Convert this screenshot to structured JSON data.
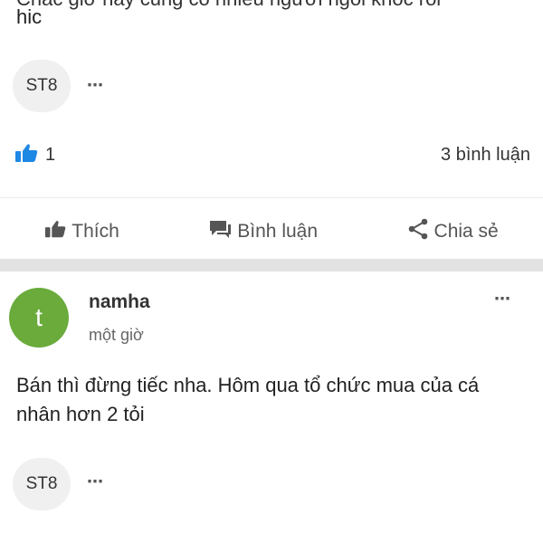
{
  "post1": {
    "cut_text": "Chắc giờ này cũng có nhiều người ngồi khóc rồi",
    "text_tail": "hic",
    "tag_label": "ST8",
    "like_count": "1",
    "comments_count": "3 bình luận"
  },
  "actions": {
    "like_label": "Thích",
    "comment_label": "Bình luận",
    "share_label": "Chia sẻ"
  },
  "post2": {
    "avatar_letter": "t",
    "author": "namha",
    "time": "một giờ",
    "body": "Bán thì đừng tiếc nha. Hôm qua tổ chức mua của cá nhân hơn 2 tỏi",
    "tag_label": "ST8"
  },
  "colors": {
    "accent_blue": "#1e88e5",
    "avatar_green": "#6aab3c",
    "divider": "#e2e2e2"
  },
  "icons": {
    "more": "⋯",
    "like": "thumbs-up-icon",
    "comment": "comment-icon",
    "share": "share-icon"
  }
}
